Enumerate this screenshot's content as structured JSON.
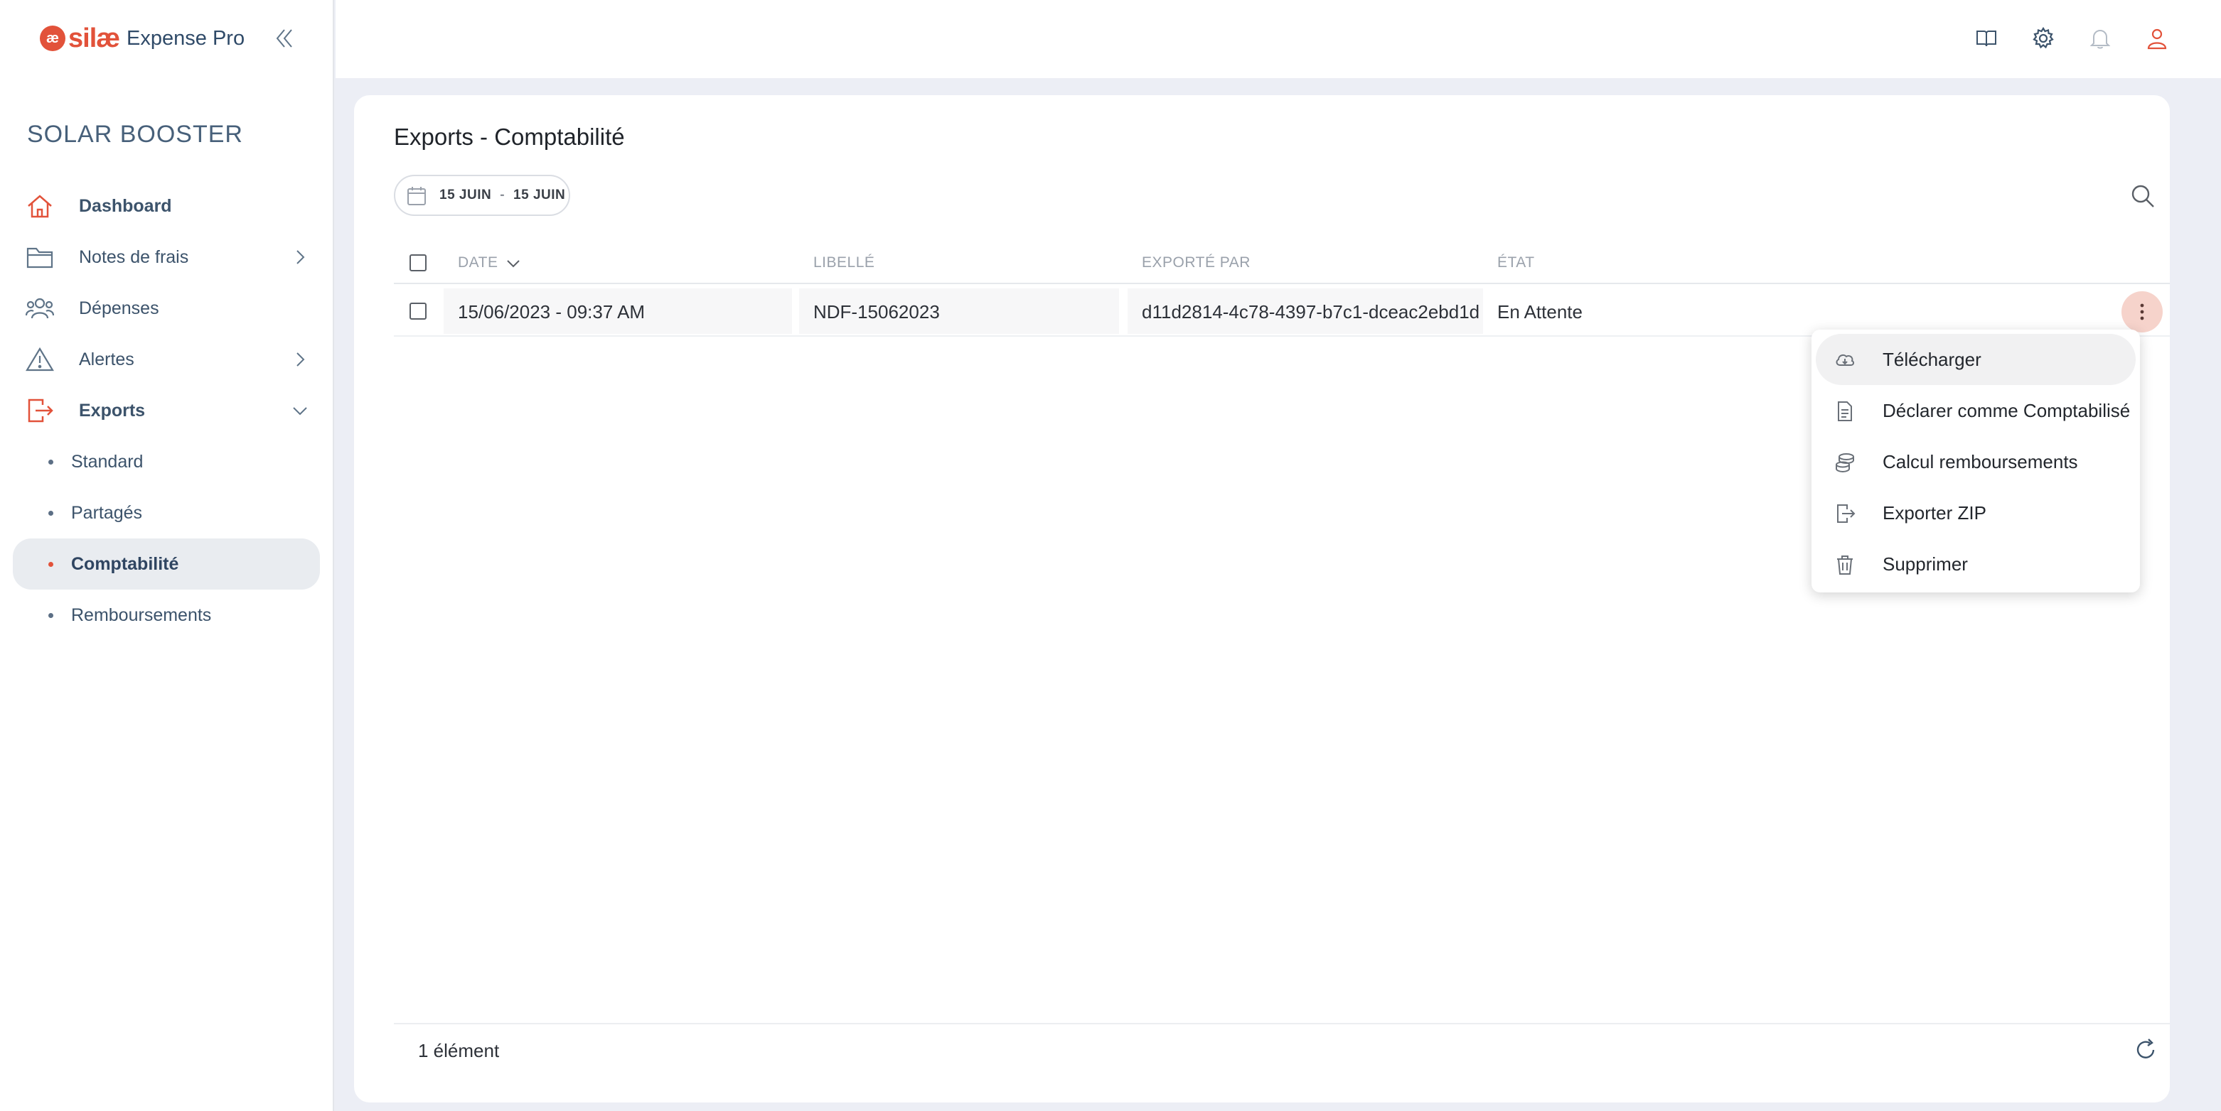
{
  "brand": {
    "mark": "æ",
    "name": "silæ",
    "product": "Expense Pro"
  },
  "sidebar": {
    "company": "SOLAR BOOSTER",
    "items": [
      {
        "label": "Dashboard",
        "icon": "home-icon"
      },
      {
        "label": "Notes de frais",
        "icon": "folder-icon"
      },
      {
        "label": "Dépenses",
        "icon": "users-icon"
      },
      {
        "label": "Alertes",
        "icon": "warning-icon"
      },
      {
        "label": "Exports",
        "icon": "export-icon"
      }
    ],
    "sub_items": [
      {
        "label": "Standard"
      },
      {
        "label": "Partagés"
      },
      {
        "label": "Comptabilité"
      },
      {
        "label": "Remboursements"
      }
    ]
  },
  "topbar": {
    "icons": [
      "book-icon",
      "gear-icon",
      "bell-icon",
      "user-icon"
    ]
  },
  "page": {
    "title": "Exports - Comptabilité",
    "date_from": "15 JUIN",
    "date_separator": "-",
    "date_to": "15 JUIN"
  },
  "table": {
    "columns": [
      "DATE",
      "LIBELLÉ",
      "EXPORTÉ PAR",
      "ÉTAT"
    ],
    "rows": [
      {
        "date": "15/06/2023 - 09:37 AM",
        "label": "NDF-15062023",
        "exported_by": "d11d2814-4c78-4397-b7c1-dceac2ebd1d",
        "state": "En Attente"
      }
    ]
  },
  "menu": {
    "items": [
      {
        "label": "Télécharger",
        "icon": "cloud-download-icon"
      },
      {
        "label": "Déclarer comme Comptabilisé",
        "icon": "document-icon"
      },
      {
        "label": "Calcul remboursements",
        "icon": "coins-icon"
      },
      {
        "label": "Exporter ZIP",
        "icon": "file-export-icon"
      },
      {
        "label": "Supprimer",
        "icon": "trash-icon"
      }
    ]
  },
  "footer": {
    "count": "1 élément"
  },
  "colors": {
    "accent": "#e2523a",
    "nav_text": "#3c536b",
    "active_bg": "#e9ecf0",
    "kebab_bg": "#f6d3cb"
  }
}
